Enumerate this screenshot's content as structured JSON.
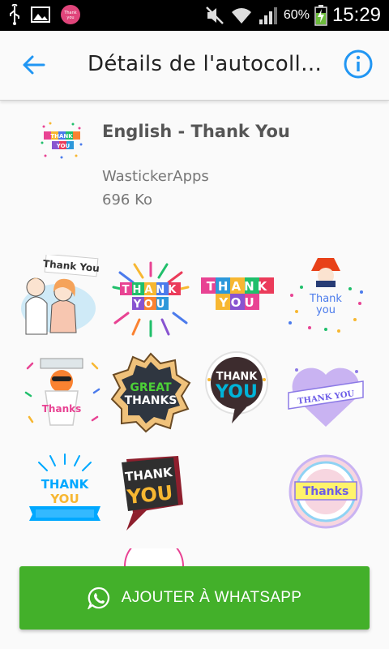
{
  "status_bar": {
    "battery": "60%",
    "time": "15:29"
  },
  "toolbar": {
    "title": "Détails de l'autocoll…"
  },
  "pack": {
    "name": "English - Thank You",
    "publisher": "WastickerApps",
    "size": "696 Ko",
    "tray_text": [
      "THANK",
      "YOU"
    ]
  },
  "stickers": [
    {
      "id": "couple",
      "text": "Thank You"
    },
    {
      "id": "confetti-letters",
      "text": [
        "THANK",
        "YOU"
      ]
    },
    {
      "id": "color-blocks",
      "text": [
        "THANK",
        "YOU"
      ]
    },
    {
      "id": "girl-confetti",
      "text": [
        "Thank",
        "you"
      ]
    },
    {
      "id": "orange-character",
      "text": "Thanks"
    },
    {
      "id": "great-thanks",
      "text": [
        "GREAT",
        "THANKS"
      ]
    },
    {
      "id": "speech-bubble",
      "text": [
        "THANK",
        "YOU"
      ]
    },
    {
      "id": "purple-heart",
      "text": "THANK YOU"
    },
    {
      "id": "ribbon",
      "text": [
        "THANK",
        "YOU"
      ]
    },
    {
      "id": "dark-3d",
      "text": [
        "THANK",
        "YOU"
      ]
    },
    {
      "id": "pastel-circle",
      "text": "Thanks"
    }
  ],
  "add_button": {
    "label": "AJOUTER À WHATSAPP"
  },
  "colors": {
    "accent": "#2196f3",
    "button": "#43b02a"
  }
}
